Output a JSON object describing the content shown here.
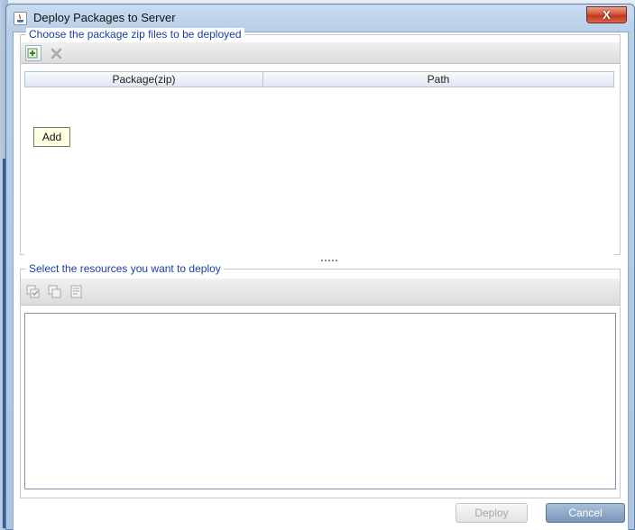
{
  "window": {
    "title": "Deploy Packages to Server",
    "close_label": "X"
  },
  "packages_group": {
    "legend": "Choose the package zip files to be deployed",
    "toolbar": {
      "add_icon": "add-icon",
      "remove_icon": "remove-icon"
    },
    "columns": [
      "Package(zip)",
      "Path"
    ],
    "rows": [],
    "tooltip": "Add"
  },
  "resources_group": {
    "legend": "Select the resources you want to deploy",
    "toolbar": {
      "icons": [
        "select-all-icon",
        "deselect-all-icon",
        "invert-selection-icon"
      ]
    }
  },
  "footer": {
    "deploy_label": "Deploy",
    "cancel_label": "Cancel"
  },
  "colors": {
    "legend_text": "#1c3fa0",
    "tooltip_bg": "#ffffe1",
    "close_red": "#c0381f",
    "cancel_blue": "#7896ba"
  }
}
